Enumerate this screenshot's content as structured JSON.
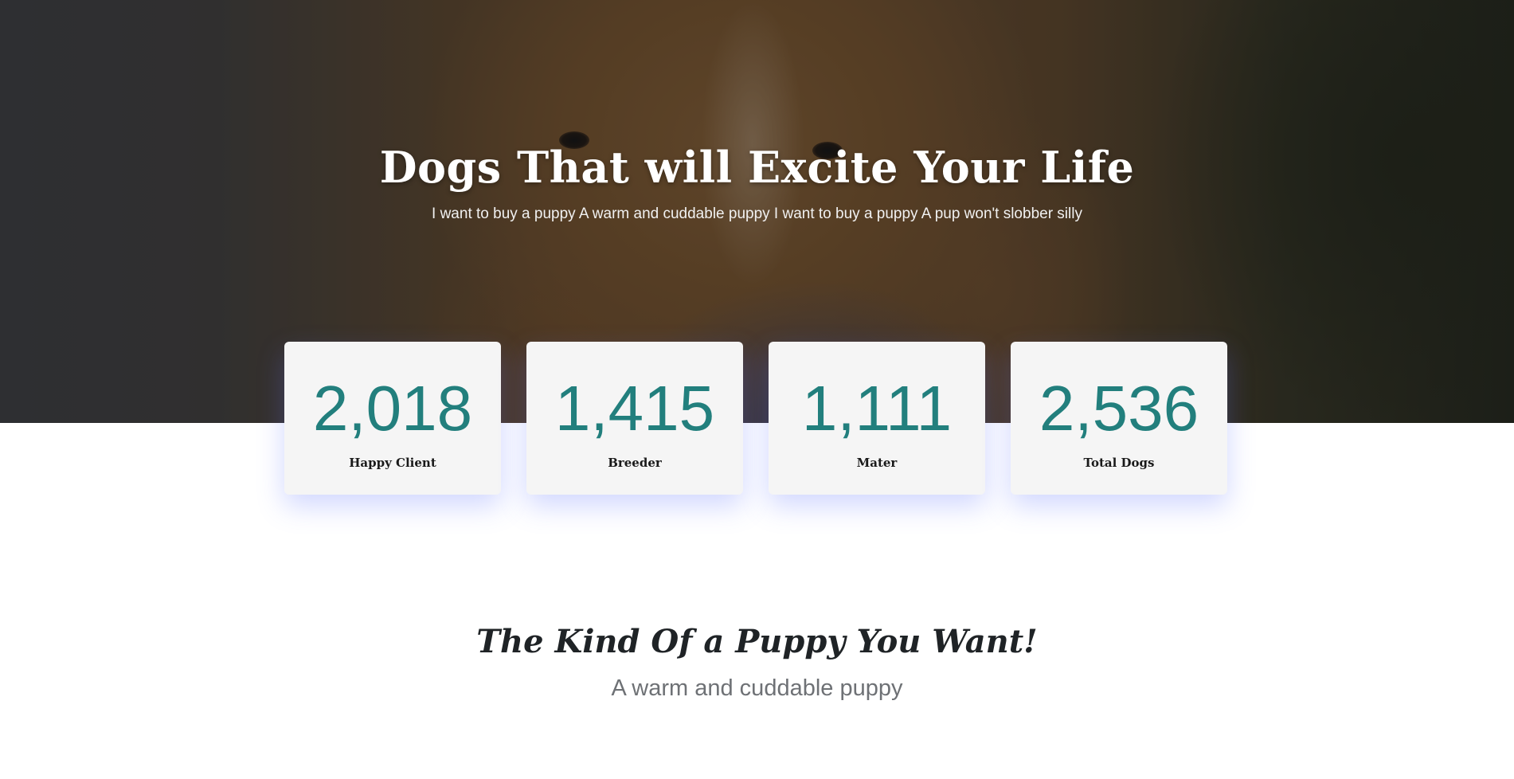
{
  "hero": {
    "title": "Dogs That will Excite Your Life",
    "subtitle": "I want to buy a puppy A warm and cuddable puppy I want to buy a puppy A pup won't slobber silly"
  },
  "stats": [
    {
      "value": "2,018",
      "label": "Happy Client"
    },
    {
      "value": "1,415",
      "label": "Breeder"
    },
    {
      "value": "1,111",
      "label": "Mater"
    },
    {
      "value": "2,536",
      "label": "Total Dogs"
    }
  ],
  "section": {
    "title": "The Kind Of a Puppy You Want!",
    "subtitle": "A warm and cuddable puppy"
  },
  "colors": {
    "stat_value": "#227f7d",
    "card_background": "#f5f5f5",
    "card_glow": "#5a6eff"
  }
}
